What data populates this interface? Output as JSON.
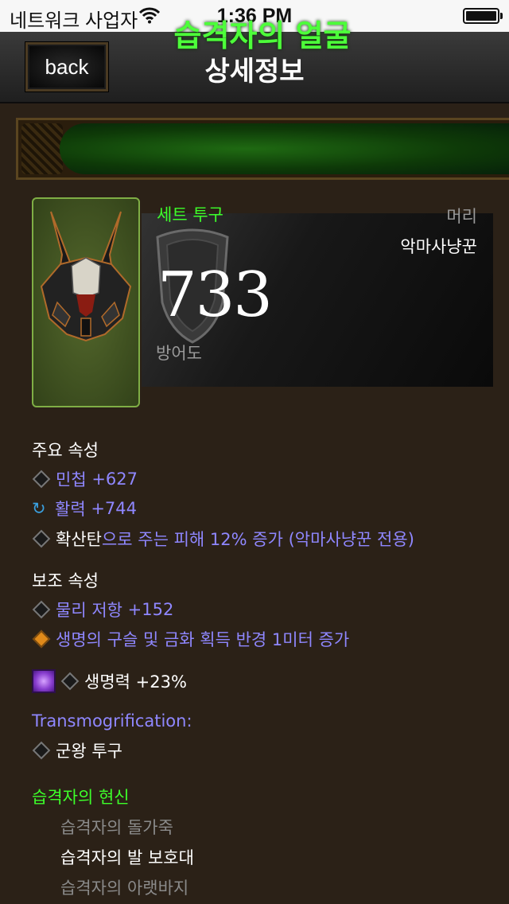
{
  "status": {
    "carrier": "네트워크 사업자",
    "time": "1:36 PM"
  },
  "nav": {
    "back_label": "back",
    "title": "상세정보"
  },
  "item": {
    "name": "습격자의 얼굴",
    "type": "세트 투구",
    "slot": "머리",
    "class": "악마사냥꾼",
    "armor": "733",
    "armor_label": "방어도"
  },
  "primary": {
    "heading": "주요 속성",
    "attrs": [
      {
        "name": "민첩",
        "value": "+627"
      },
      {
        "name": "활력",
        "value": "+744"
      },
      {
        "prefix": "확산탄",
        "text": "으로 주는 피해 12% 증가 (악마사냥꾼 전용)"
      }
    ]
  },
  "secondary": {
    "heading": "보조 속성",
    "attrs": [
      {
        "name": "물리 저항",
        "value": "+152"
      },
      {
        "text": "생명의 구슬 및 금화 획득 반경 1미터 증가"
      }
    ]
  },
  "socket": {
    "text": "생명력 +23%"
  },
  "transmog": {
    "label": "Transmogrification:",
    "value": "군왕 투구"
  },
  "set": {
    "name": "습격자의 현신",
    "items": [
      "습격자의 돌가죽",
      "습격자의 발 보호대",
      "습격자의 아랫바지"
    ]
  },
  "colors": {
    "set_green": "#3dff2a",
    "magic_blue": "#8f87ff",
    "background": "#2b2117"
  }
}
